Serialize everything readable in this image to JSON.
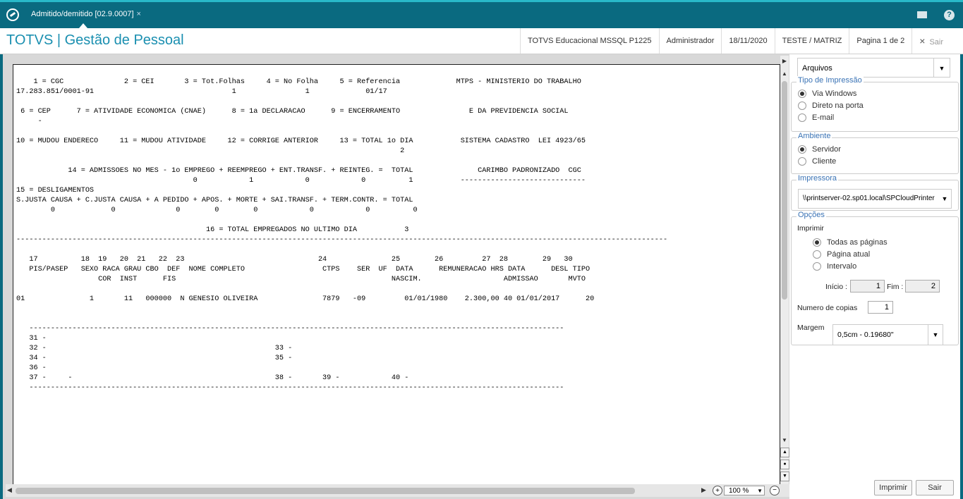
{
  "tab": {
    "title": "Admitido/demitido [02.9.0007]",
    "close": "×"
  },
  "header": {
    "app_title": "TOTVS | Gestão de Pessoal",
    "environment": "TOTVS Educacional MSSQL P1225",
    "user": "Administrador",
    "date": "18/11/2020",
    "company": "TESTE / MATRIZ",
    "page_info": "Pagina 1 de 2",
    "close_label": "Sair",
    "close_icon": "×"
  },
  "report": {
    "lines": [
      "    1 = CGC              2 = CEI       3 = Tot.Folhas     4 = No Folha     5 = Referencia             MTPS - MINISTERIO DO TRABALHO",
      "17.283.851/0001-91                                1                1             01/17",
      "",
      " 6 = CEP      7 = ATIVIDADE ECONOMICA (CNAE)      8 = 1a DECLARACAO      9 = ENCERRAMENTO                E DA PREVIDENCIA SOCIAL",
      "     -",
      "",
      "10 = MUDOU ENDERECO     11 = MUDOU ATIVIDADE     12 = CORRIGE ANTERIOR     13 = TOTAL 1o DIA           SISTEMA CADASTRO  LEI 4923/65",
      "                                                                                         2",
      "",
      "            14 = ADMISSOES NO MES - 1o EMPREGO + REEMPREGO + ENT.TRANSF. + REINTEG. =  TOTAL               CARIMBO PADRONIZADO  CGC",
      "                                         0            1            0            0          1           -----------------------------",
      "15 = DESLIGAMENTOS",
      "S.JUSTA CAUSA + C.JUSTA CAUSA + A PEDIDO + APOS. + MORTE + SAI.TRANSF. + TERM.CONTR. = TOTAL",
      "        0             0              0        0        0            0            0          0",
      "",
      "                                            16 = TOTAL EMPREGADOS NO ULTIMO DIA           3",
      "-------------------------------------------------------------------------------------------------------------------------------------------------------",
      "",
      "   17          18  19   20  21   22  23                               24               25        26         27  28        29   30",
      "   PIS/PASEP   SEXO RACA GRAU CBO  DEF  NOME COMPLETO                  CTPS    SER  UF  DATA      REMUNERACAO HRS DATA      DESL TIPO",
      "                   COR  INST      FIS                                                  NASCIM.                   ADMISSAO       MVTO",
      "",
      "01               1       11   000000  N GENESIO OLIVEIRA               7879   -09         01/01/1980    2.300,00 40 01/01/2017      20",
      "",
      "",
      "   ----------------------------------------------------------------------------------------------------------------------------",
      "   31 -",
      "   32 -                                                     33 -",
      "   34 -                                                     35 -",
      "   36 -",
      "   37 -     -                                               38 -       39 -            40 -",
      "   ----------------------------------------------------------------------------------------------------------------------------"
    ]
  },
  "viewer": {
    "zoom": "100 %"
  },
  "panel": {
    "output_select": "Arquivos",
    "print_type": {
      "legend": "Tipo de Impressão",
      "options": [
        "Via Windows",
        "Direto na porta",
        "E-mail"
      ],
      "selected": "Via Windows"
    },
    "environment": {
      "legend": "Ambiente",
      "options": [
        "Servidor",
        "Cliente"
      ],
      "selected": "Servidor"
    },
    "printer": {
      "legend": "Impressora",
      "value": "\\\\printserver-02.sp01.local\\SPCloudPrinter"
    },
    "options": {
      "legend": "Opções",
      "print_label": "Imprimir",
      "pages": [
        "Todas as páginas",
        "Página atual",
        "Intervalo"
      ],
      "selected": "Todas as páginas",
      "start_label": "Início :",
      "start_value": "1",
      "end_label": "Fim :",
      "end_value": "2",
      "copies_label": "Numero de copias",
      "copies_value": "1",
      "margin_label": "Margem",
      "margin_value": "0,5cm - 0.19680\""
    },
    "print_button": "Imprimir",
    "exit_button": "Sair"
  }
}
